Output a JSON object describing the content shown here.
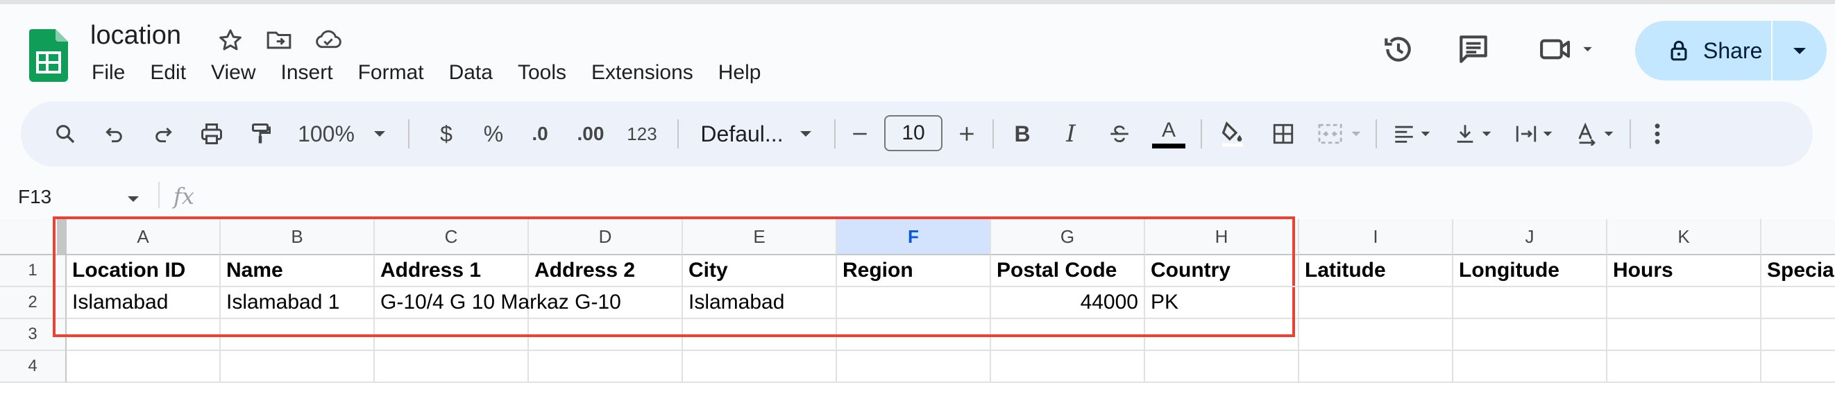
{
  "app": {
    "title": "location",
    "menu": [
      "File",
      "Edit",
      "View",
      "Insert",
      "Format",
      "Data",
      "Tools",
      "Extensions",
      "Help"
    ],
    "share_label": "Share",
    "brand_color": "#0f9d58",
    "share_bg": "#c2e7ff"
  },
  "toolbar": {
    "zoom": "100%",
    "currency": "$",
    "percent": "%",
    "decrease_decimal": ".0",
    "increase_decimal": ".00",
    "number_format": "123",
    "font_family": "Defaul...",
    "font_size": "10",
    "text_color_bar": "#000000"
  },
  "formula_bar": {
    "cell_ref": "F13",
    "fx": "fx",
    "value": ""
  },
  "sheet": {
    "selected_column": "F",
    "columns": [
      "A",
      "B",
      "C",
      "D",
      "E",
      "F",
      "G",
      "H",
      "I",
      "J",
      "K",
      ""
    ],
    "row_numbers": [
      "1",
      "2",
      "3",
      "4"
    ],
    "rows": [
      [
        "Location ID",
        "Name",
        "Address 1",
        "Address 2",
        "City",
        "Region",
        "Postal Code",
        "Country",
        "Latitude",
        "Longitude",
        "Hours",
        "Special"
      ],
      [
        "Islamabad",
        "Islamabad 1",
        "G-10/4 G 10 Markaz G-10",
        "",
        "Islamabad",
        "",
        "44000",
        "PK",
        "",
        "",
        "",
        ""
      ],
      [
        "",
        "",
        "",
        "",
        "",
        "",
        "",
        "",
        "",
        "",
        "",
        ""
      ],
      [
        "",
        "",
        "",
        "",
        "",
        "",
        "",
        "",
        "",
        "",
        "",
        ""
      ]
    ],
    "highlight_color": "#ea4335"
  }
}
